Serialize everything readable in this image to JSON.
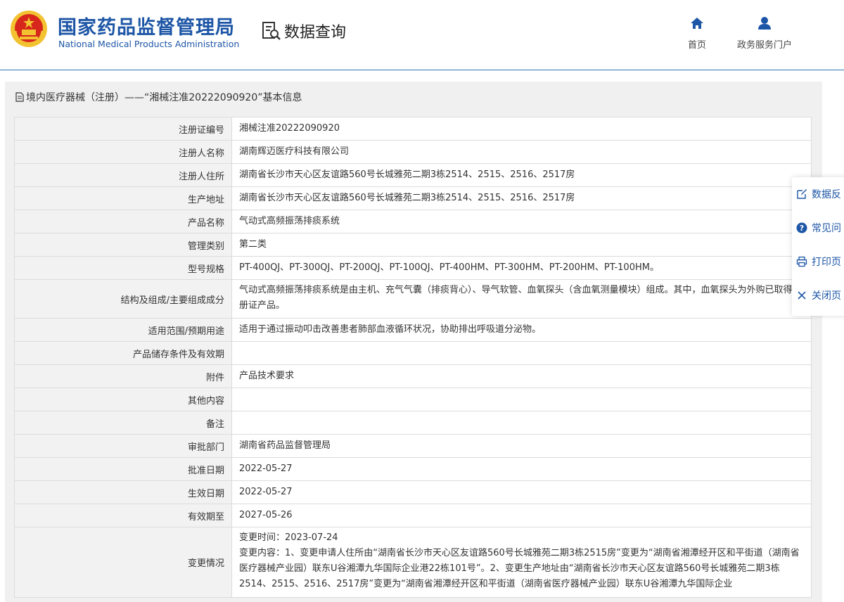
{
  "header": {
    "agency_name_cn": "国家药品监督管理局",
    "agency_name_en": "National Medical Products Administration",
    "section_title": "数据查询",
    "nav": [
      {
        "label": "首页"
      },
      {
        "label": "政务服务门户"
      }
    ]
  },
  "panel": {
    "title": "境内医疗器械（注册）——“湘械注准20222090920”基本信息",
    "rows": [
      {
        "key": "注册证编号",
        "value": "湘械注准20222090920"
      },
      {
        "key": "注册人名称",
        "value": "湖南辉迈医疗科技有限公司"
      },
      {
        "key": "注册人住所",
        "value": "湖南省长沙市天心区友谊路560号长城雅苑二期3栋2514、2515、2516、2517房"
      },
      {
        "key": "生产地址",
        "value": "湖南省长沙市天心区友谊路560号长城雅苑二期3栋2514、2515、2516、2517房"
      },
      {
        "key": "产品名称",
        "value": "气动式高频振荡排痰系统"
      },
      {
        "key": "管理类别",
        "value": "第二类"
      },
      {
        "key": "型号规格",
        "value": "PT-400QJ、PT-300QJ、PT-200QJ、PT-100QJ、PT-400HM、PT-300HM、PT-200HM、PT-100HM。"
      },
      {
        "key": "结构及组成/主要组成成分",
        "value": "气动式高频振荡排痰系统是由主机、充气气囊（排痰背心）、导气软管、血氧探头（含血氧测量模块）组成。其中，血氧探头为外购已取得注册证产品。"
      },
      {
        "key": "适用范围/预期用途",
        "value": "适用于通过振动叩击改善患者肺部血液循环状况，协助排出呼吸道分泌物。"
      },
      {
        "key": "产品储存条件及有效期",
        "value": ""
      },
      {
        "key": "附件",
        "value": "产品技术要求"
      },
      {
        "key": "其他内容",
        "value": ""
      },
      {
        "key": "备注",
        "value": ""
      },
      {
        "key": "审批部门",
        "value": "湖南省药品监督管理局"
      },
      {
        "key": "批准日期",
        "value": "2022-05-27"
      },
      {
        "key": "生效日期",
        "value": "2022-05-27"
      },
      {
        "key": "有效期至",
        "value": "2027-05-26"
      },
      {
        "key": "变更情况",
        "value": "变更时间：2023-07-24\n变更内容：1、变更申请人住所由“湖南省长沙市天心区友谊路560号长城雅苑二期3栋2515房”变更为“湖南省湘潭经开区和平街道（湖南省医疗器械产业园）联东U谷湘潭九华国际企业港22栋101号”。2、变更生产地址由“湖南省长沙市天心区友谊路560号长城雅苑二期3栋2514、2515、2516、2517房”变更为“湖南省湘潭经开区和平街道（湖南省医疗器械产业园）联东U谷湘潭九华国际企业"
      }
    ]
  },
  "side_tools": [
    {
      "label": "数据反",
      "icon": "edit-icon"
    },
    {
      "label": "常见问",
      "icon": "question-icon"
    },
    {
      "label": "打印页",
      "icon": "printer-icon"
    },
    {
      "label": "关闭页",
      "icon": "close-icon"
    }
  ],
  "colors": {
    "brand": "#1d56a6",
    "emblem_red": "#d7261b",
    "emblem_gold": "#f2c230"
  }
}
